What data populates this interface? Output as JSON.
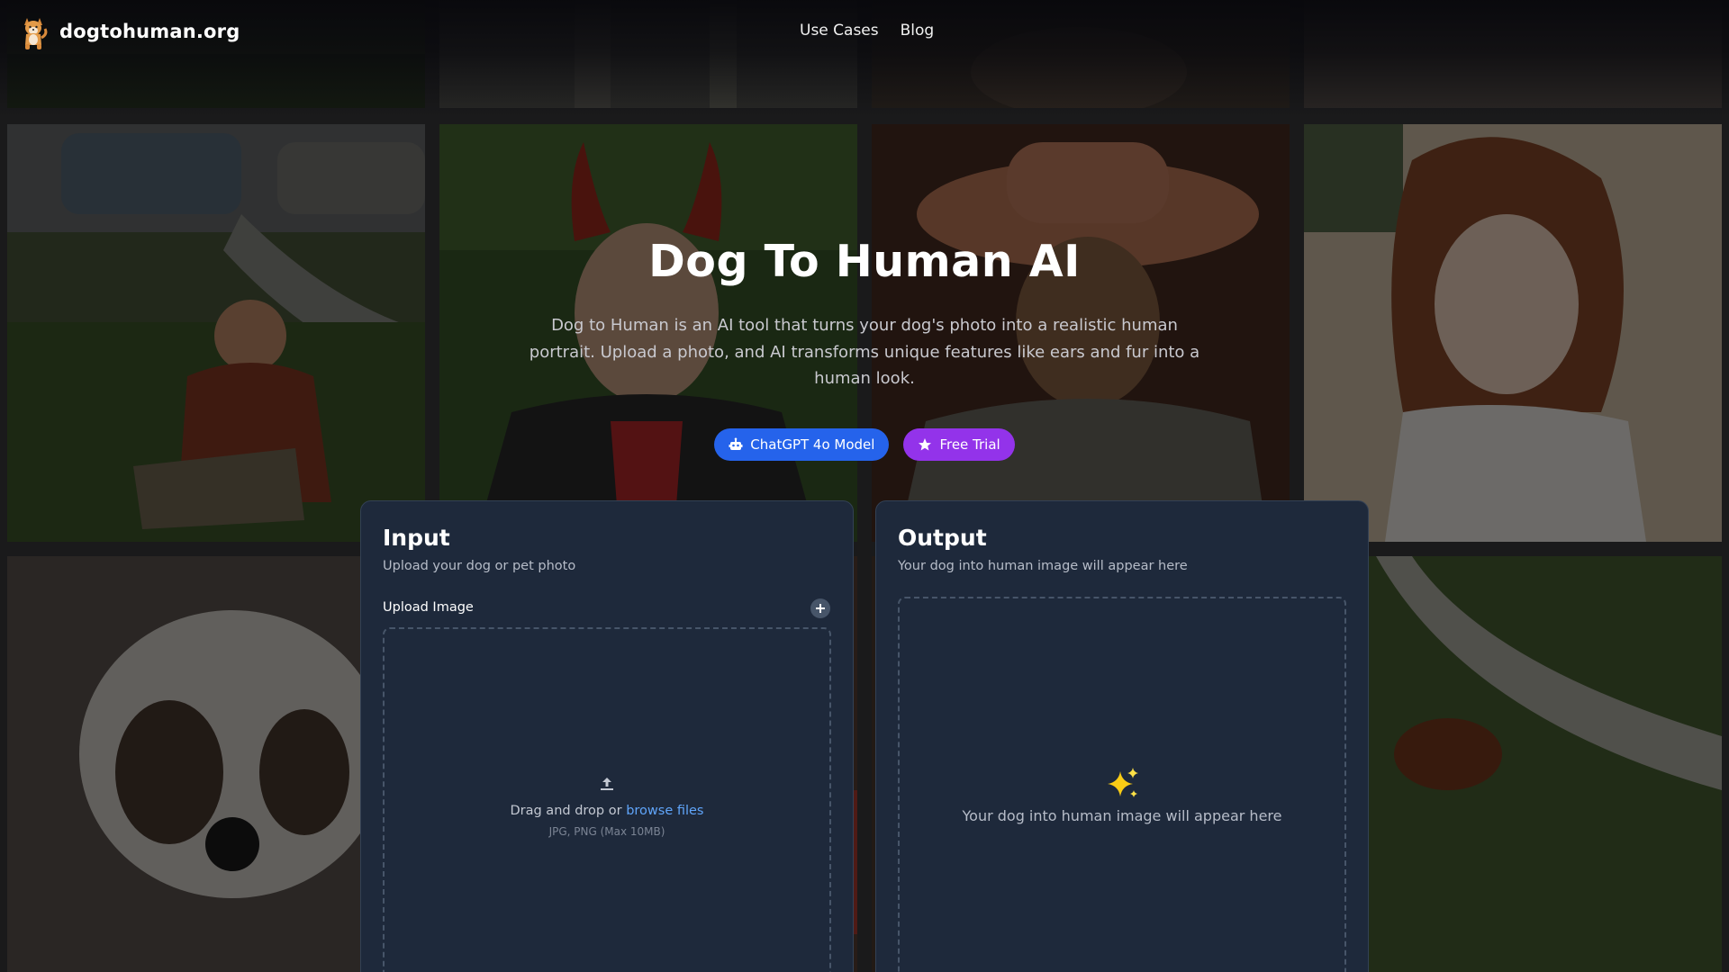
{
  "site": {
    "name": "dogtohuman.org",
    "logo_icon": "shiba-dog-icon"
  },
  "nav": {
    "items": [
      {
        "label": "Use Cases"
      },
      {
        "label": "Blog"
      }
    ]
  },
  "hero": {
    "title": "Dog To Human AI",
    "description": "Dog to Human is an AI tool that turns your dog's photo into a realistic human portrait. Upload a photo, and AI transforms unique features like ears and fur into a human look.",
    "buttons": [
      {
        "label": "ChatGPT 4o Model",
        "icon": "robot-icon",
        "color": "#2563eb"
      },
      {
        "label": "Free Trial",
        "icon": "star-icon",
        "color": "#9333ea"
      }
    ]
  },
  "input_panel": {
    "title": "Input",
    "subtitle": "Upload your dog or pet photo",
    "upload_label": "Upload Image",
    "dropzone": {
      "text_prefix": "Drag and drop or",
      "link_text": "browse files",
      "hint": "JPG, PNG (Max 10MB)"
    }
  },
  "output_panel": {
    "title": "Output",
    "subtitle": "Your dog into human image will appear here",
    "placeholder": "Your dog into human image will appear here"
  },
  "colors": {
    "panel_bg": "#1e293b",
    "accent_blue": "#2563eb",
    "accent_purple": "#9333ea",
    "link": "#60a5fa"
  }
}
